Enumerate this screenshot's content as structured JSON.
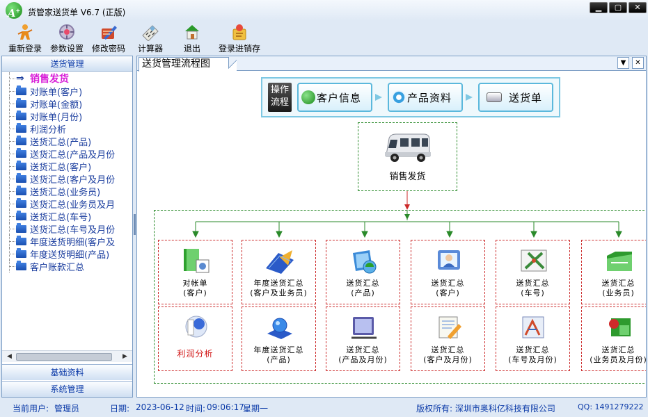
{
  "window": {
    "title": "货管家送货单  V6.7 (正版)",
    "logo_text": "A"
  },
  "toolbar": [
    {
      "label": "重新登录",
      "icon": "relogin-icon"
    },
    {
      "label": "参数设置",
      "icon": "settings-icon"
    },
    {
      "label": "修改密码",
      "icon": "password-icon"
    },
    {
      "label": "计算器",
      "icon": "calculator-icon"
    },
    {
      "label": "退出",
      "icon": "exit-icon"
    },
    {
      "label": "登录进销存",
      "icon": "login-erp-icon"
    }
  ],
  "sidebar": {
    "header": "送货管理",
    "items": [
      {
        "label": "销售发货",
        "selected": true
      },
      {
        "label": "对账单(客户)"
      },
      {
        "label": "对账单(金额)"
      },
      {
        "label": "对账单(月份)"
      },
      {
        "label": "利润分析"
      },
      {
        "label": "送货汇总(产品)"
      },
      {
        "label": "送货汇总(产品及月份"
      },
      {
        "label": "送货汇总(客户)"
      },
      {
        "label": "送货汇总(客户及月份"
      },
      {
        "label": "送货汇总(业务员)"
      },
      {
        "label": "送货汇总(业务员及月"
      },
      {
        "label": "送货汇总(车号)"
      },
      {
        "label": "送货汇总(车号及月份"
      },
      {
        "label": "年度送货明细(客户及"
      },
      {
        "label": "年度送货明细(产品)"
      },
      {
        "label": "客户账款汇总"
      }
    ],
    "footer_tabs": [
      "基础资料",
      "系统管理"
    ]
  },
  "main": {
    "tab_label": "送货管理流程图",
    "flow": {
      "label": "操作流程",
      "steps": [
        "客户信息",
        "产品资料",
        "送货单"
      ]
    },
    "center_label": "销售发货",
    "cells_top": [
      {
        "line1": "对帐单",
        "line2": "(客户)"
      },
      {
        "line1": "年度送货汇总",
        "line2": "(客户及业务员)"
      },
      {
        "line1": "送货汇总",
        "line2": "(产品)"
      },
      {
        "line1": "送货汇总",
        "line2": "(客户)"
      },
      {
        "line1": "送货汇总",
        "line2": "(车号)"
      },
      {
        "line1": "送货汇总",
        "line2": "(业务员)"
      }
    ],
    "cells_bottom": [
      {
        "line1": "利润分析",
        "line2": ""
      },
      {
        "line1": "年度送货汇总",
        "line2": "(产品)"
      },
      {
        "line1": "送货汇总",
        "line2": "(产品及月份)"
      },
      {
        "line1": "送货汇总",
        "line2": "(客户及月份)"
      },
      {
        "line1": "送货汇总",
        "line2": "(车号及月份)"
      },
      {
        "line1": "送货汇总",
        "line2": "(业务员及月份)"
      }
    ]
  },
  "statusbar": {
    "user_label": "当前用户:",
    "user": "管理员",
    "date_label": "日期:",
    "date": "2023-06-12",
    "time_label": "时间:",
    "time": "09:06:17",
    "weekday": "星期一",
    "copyright": "版权所有: 深圳市奥科亿科技有限公司",
    "qq": "QQ: 1491279222"
  },
  "colors": {
    "accent": "#0b3aa8",
    "selected": "#d81ed8",
    "flow": "#7ec8e3",
    "green": "#2a8a2a",
    "red": "#cc2a2a"
  }
}
